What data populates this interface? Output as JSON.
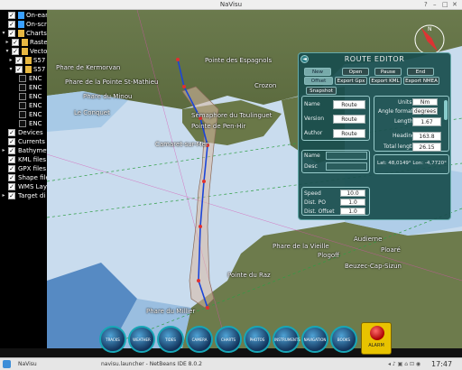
{
  "window": {
    "title": "NaVisu",
    "controls": [
      "?",
      "–",
      "□",
      "✕"
    ]
  },
  "layers": [
    {
      "label": "On-ear",
      "checked": true,
      "expand": "",
      "indent": 0,
      "icon": "#3aa0ff"
    },
    {
      "label": "On-scr",
      "checked": true,
      "expand": "",
      "indent": 0,
      "icon": "#3aa0ff"
    },
    {
      "label": "Charts",
      "checked": true,
      "expand": "−",
      "indent": 0,
      "icon": "#e7b842"
    },
    {
      "label": "Raster",
      "checked": true,
      "expand": "+",
      "indent": 1,
      "icon": "#e7b842"
    },
    {
      "label": "Vector",
      "checked": true,
      "expand": "−",
      "indent": 1,
      "icon": "#e7b842"
    },
    {
      "label": "S57 c",
      "checked": true,
      "expand": "+",
      "indent": 2,
      "icon": "#e7b842"
    },
    {
      "label": "S57 c",
      "checked": true,
      "expand": "−",
      "indent": 2,
      "icon": "#e7b842"
    },
    {
      "label": "ENC",
      "checked": false,
      "expand": "",
      "indent": 3,
      "icon": ""
    },
    {
      "label": "ENC",
      "checked": false,
      "expand": "",
      "indent": 3,
      "icon": ""
    },
    {
      "label": "ENC",
      "checked": false,
      "expand": "",
      "indent": 3,
      "icon": ""
    },
    {
      "label": "ENC",
      "checked": false,
      "expand": "",
      "indent": 3,
      "icon": ""
    },
    {
      "label": "ENC",
      "checked": false,
      "expand": "",
      "indent": 3,
      "icon": ""
    },
    {
      "label": "ENC",
      "checked": false,
      "expand": "",
      "indent": 3,
      "icon": ""
    },
    {
      "label": "Devices",
      "checked": true,
      "expand": "",
      "indent": 0,
      "icon": ""
    },
    {
      "label": "Currents",
      "checked": true,
      "expand": "",
      "indent": 0,
      "icon": ""
    },
    {
      "label": "Bathymet",
      "checked": true,
      "expand": "+",
      "indent": 0,
      "icon": ""
    },
    {
      "label": "KML files",
      "checked": true,
      "expand": "",
      "indent": 0,
      "icon": ""
    },
    {
      "label": "GPX files",
      "checked": true,
      "expand": "",
      "indent": 0,
      "icon": ""
    },
    {
      "label": "Shape file",
      "checked": true,
      "expand": "",
      "indent": 0,
      "icon": ""
    },
    {
      "label": "WMS Layer",
      "checked": true,
      "expand": "",
      "indent": 0,
      "icon": ""
    },
    {
      "label": "Target di",
      "checked": true,
      "expand": "+",
      "indent": 0,
      "icon": ""
    }
  ],
  "map_labels": [
    "Phare de Kermorvan",
    "Phare de la Pointe St-Mathieu",
    "Pointe des Espagnols",
    "Phare du Minou",
    "Sémaphore du Toulinguet",
    "Pointe de Pen-Hir",
    "Le Conquet",
    "Camaret-sur-Mer",
    "Crozon",
    "Phare de la Vieille",
    "Pointe du Raz",
    "Plogoff",
    "Beuzec-Cap-Sizun",
    "Audierne",
    "Ploaré",
    "Phare du Millier"
  ],
  "route_editor": {
    "title": "ROUTE EDITOR",
    "close": "◄",
    "row1": [
      "New",
      "Open",
      "Pause",
      "End"
    ],
    "row1_selected": 0,
    "row2": [
      "Offset",
      "Export Gpx",
      "Export KML",
      "Export NMEA"
    ],
    "row2_selected": 0,
    "snapshot": "Snapshot",
    "meta": [
      {
        "label": "Name",
        "value": "Route"
      },
      {
        "label": "Version",
        "value": "Route"
      },
      {
        "label": "Author",
        "value": "Route"
      }
    ],
    "units_label": "Units",
    "units_value": "Nm",
    "angle_label": "Angle format",
    "angle_value": "degrees",
    "length_label": "Length",
    "length_value": "1.67",
    "heading_label": "Heading",
    "heading_value": "163.8",
    "total_label": "Total length",
    "total_value": "26.15",
    "point_name_label": "Name",
    "point_desc_label": "Desc",
    "latlon": "Lat: 48,0149°  Lon: -4,7720°",
    "speed_label": "Speed",
    "speed_value": "10.0",
    "distpo_label": "Dist. PO",
    "distpo_value": "1.0",
    "distoffset_label": "Dist. Offset",
    "distoffset_value": "1.0"
  },
  "dock": [
    "TRACKS",
    "WEATHER",
    "TIDES",
    "CAMERA",
    "CHARTS",
    "PHOTOS",
    "INSTRUMENTS",
    "NAVIGATION",
    "BOOKS"
  ],
  "alarm_label": "ALARM",
  "taskbar": {
    "apps": [
      "NaVisu",
      "navisu.launcher - NetBeans IDE 8.0.2"
    ],
    "clock": "17:47"
  }
}
